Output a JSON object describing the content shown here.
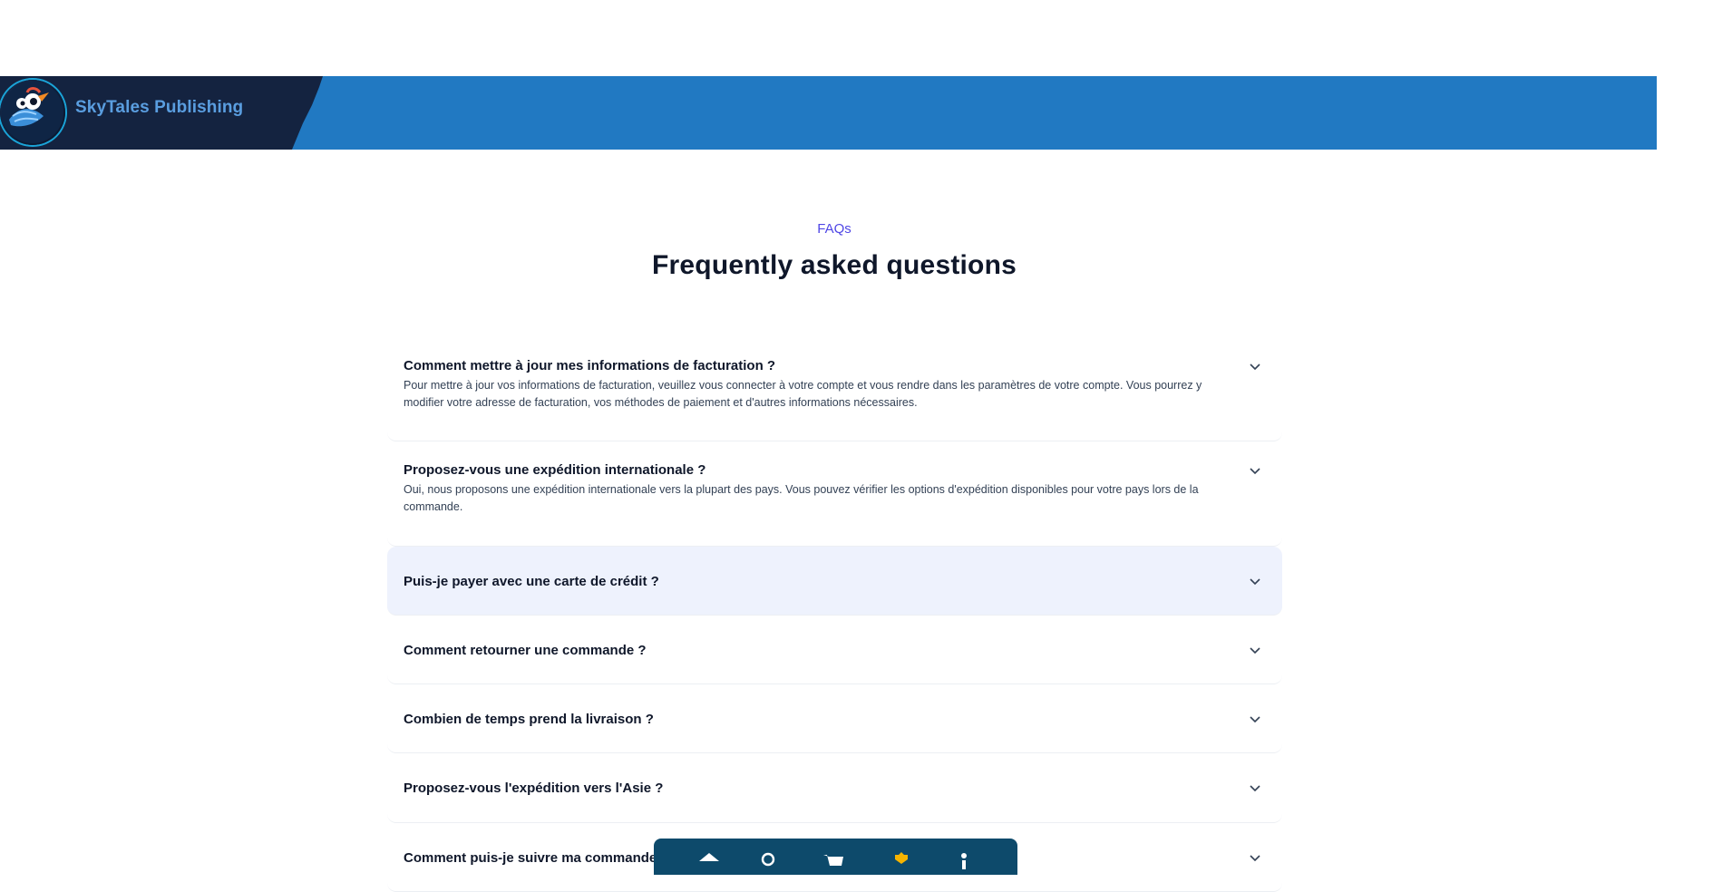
{
  "brand": {
    "name": "SkyTales Publishing"
  },
  "faq": {
    "kicker": "FAQs",
    "title": "Frequently asked questions",
    "items": [
      {
        "question": "Comment mettre à jour mes informations de facturation ?",
        "answer": "Pour mettre à jour vos informations de facturation, veuillez vous connecter à votre compte et vous rendre dans les paramètres de votre compte. Vous pourrez y modifier votre adresse de facturation, vos méthodes de paiement et d'autres informations nécessaires."
      },
      {
        "question": "Proposez-vous une expédition internationale ?",
        "answer": "Oui, nous proposons une expédition internationale vers la plupart des pays. Vous pouvez vérifier les options d'expédition disponibles pour votre pays lors de la commande."
      },
      {
        "question": "Puis-je payer avec une carte de crédit ?",
        "answer": ""
      },
      {
        "question": "Comment retourner une commande ?",
        "answer": ""
      },
      {
        "question": "Combien de temps prend la livraison ?",
        "answer": ""
      },
      {
        "question": "Proposez-vous l'expédition vers l'Asie ?",
        "answer": ""
      },
      {
        "question": "Comment puis-je suivre ma commande in",
        "answer": ""
      }
    ]
  },
  "dock": {
    "icons": [
      "home-icon",
      "search-icon",
      "cart-icon",
      "badge-icon",
      "info-icon"
    ],
    "accent": "#f5b400"
  },
  "colors": {
    "topbar": "#2179c2",
    "brand_panel": "#142340",
    "kicker": "#4f46e5",
    "active_item": "#eef2fd",
    "dock": "#0d4a6b"
  }
}
